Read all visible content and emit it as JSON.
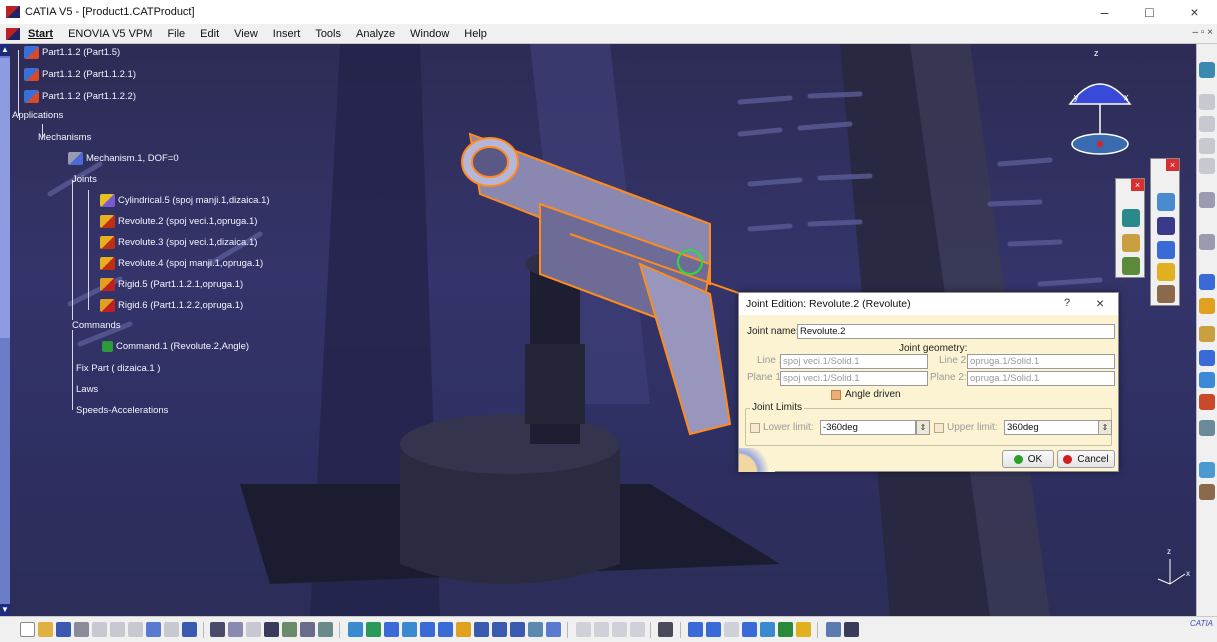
{
  "window": {
    "title": "CATIA V5 - [Product1.CATProduct]",
    "minimize": "–",
    "maximize": "□",
    "close": "×"
  },
  "menubar": {
    "items": [
      "Start",
      "ENOVIA V5 VPM",
      "File",
      "Edit",
      "View",
      "Insert",
      "Tools",
      "Analyze",
      "Window",
      "Help"
    ],
    "mdi_controls": "– ▫ ×"
  },
  "tree": {
    "part_a": "Part1.1.2 (Part1.5)",
    "part_b": "Part1.1.2 (Part1.1.2.1)",
    "part_c": "Part1.1.2 (Part1.1.2.2)",
    "applications": "Applications",
    "mechanisms": "Mechanisms",
    "mechanism": "Mechanism.1, DOF=0",
    "joints": "Joints",
    "joint_1": "Cylindrical.5 (spoj manji.1,dizaica.1)",
    "joint_2": "Revolute.2 (spoj veci.1,opruga.1)",
    "joint_3": "Revolute.3 (spoj veci.1,dizaica.1)",
    "joint_4": "Revolute.4 (spoj manji.1,opruga.1)",
    "joint_5": "Rigid.5 (Part1.1.2.1,opruga.1)",
    "joint_6": "Rigid.6 (Part1.1.2.2,opruga.1)",
    "commands": "Commands",
    "command_1": "Command.1 (Revolute.2,Angle)",
    "fix_part": "Fix Part ( dizaica.1 )",
    "laws": "Laws",
    "speeds": "Speeds-Accelerations"
  },
  "compass": {
    "z": "z",
    "y": "y",
    "x": "x"
  },
  "axes_corner": {
    "z": "z",
    "x": "x"
  },
  "dialog": {
    "title": "Joint Edition: Revolute.2 (Revolute)",
    "help": "?",
    "close": "×",
    "joint_name_label": "Joint name:",
    "joint_name_value": "Revolute.2",
    "geometry_header": "Joint geometry:",
    "line1_label": "Line 1:",
    "line1_value": "spoj veci.1/Solid.1",
    "line2_label": "Line 2:",
    "line2_value": "opruga.1/Solid.1",
    "plane1_label": "Plane 1:",
    "plane1_value": "spoj veci.1/Solid.1",
    "plane2_label": "Plane 2:",
    "plane2_value": "opruga.1/Solid.1",
    "angle_driven_label": "Angle driven",
    "limits_header": "Joint Limits",
    "lower_label": "Lower limit:",
    "lower_value": "-360deg",
    "upper_label": "Upper limit:",
    "upper_value": "360deg",
    "ok_label": "OK",
    "cancel_label": "Cancel"
  },
  "footer": {
    "brand": "CATIA"
  },
  "colors": {
    "highlight": "#ff8a1e",
    "viewport_bg": "#2e2f62",
    "dialog_bg": "#fcf3d2",
    "ok_green": "#2aa02a",
    "cancel_red": "#d02020"
  }
}
